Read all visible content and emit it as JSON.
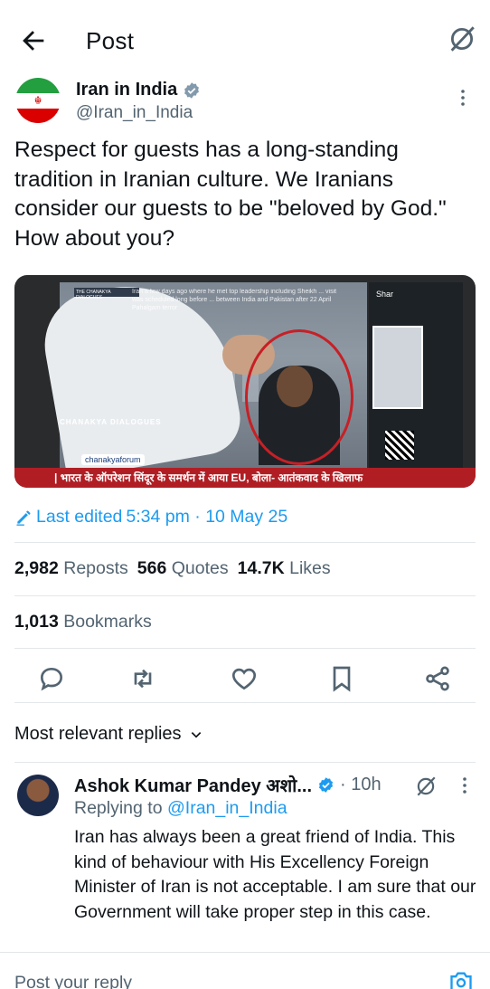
{
  "header": {
    "title": "Post"
  },
  "author": {
    "name": "Iran in India",
    "handle": "@Iran_in_India"
  },
  "tweet": {
    "text": "Respect for guests has a long-standing tradition in Iranian culture. We Iranians consider our guests to be \"beloved by God.\" How about you?"
  },
  "media": {
    "logo_text": "THE CHANAKYA DIALOGUES",
    "caption_text": "Iran a few days ago where he met top leadership including Sheikh ... visit was scheduled long before ... between India and Pakistan after 22 April Pahalgam terror",
    "share_text": "Shar",
    "band_text": "CHANAKYA DIALOGUES",
    "forum_text": "chanakyaforum",
    "ticker_text": "| भारत के ऑपरेशन सिंदूर के समर्थन में आया EU, बोला- आतंकवाद के खिलाफ"
  },
  "edited": {
    "label": "Last edited",
    "time": "5:34 pm · 10 May 25"
  },
  "stats": {
    "reposts_count": "2,982",
    "reposts_label": "Reposts",
    "quotes_count": "566",
    "quotes_label": "Quotes",
    "likes_count": "14.7K",
    "likes_label": "Likes",
    "bookmarks_count": "1,013",
    "bookmarks_label": "Bookmarks"
  },
  "replies_filter": {
    "label": "Most relevant replies"
  },
  "reply": {
    "name": "Ashok Kumar Pandey अशो...",
    "time": "· 10h",
    "replying_prefix": "Replying to",
    "replying_handle": "@Iran_in_India",
    "text": "Iran has always been a great friend of India. This kind of behaviour with His Excellency Foreign Minister of Iran is not acceptable. I am sure that our Government will take proper step in this case."
  },
  "composer": {
    "placeholder": "Post your reply"
  },
  "colors": {
    "accent": "#1d9bf0",
    "text": "#0f1419",
    "muted": "#536471",
    "divider": "#e3e7ea"
  },
  "icons": [
    "back-arrow-icon",
    "grok-icon",
    "verified-badge-icon",
    "more-icon",
    "edit-pencil-icon",
    "reply-icon",
    "repost-icon",
    "like-icon",
    "bookmark-icon",
    "share-icon",
    "chevron-down-icon",
    "camera-icon"
  ]
}
